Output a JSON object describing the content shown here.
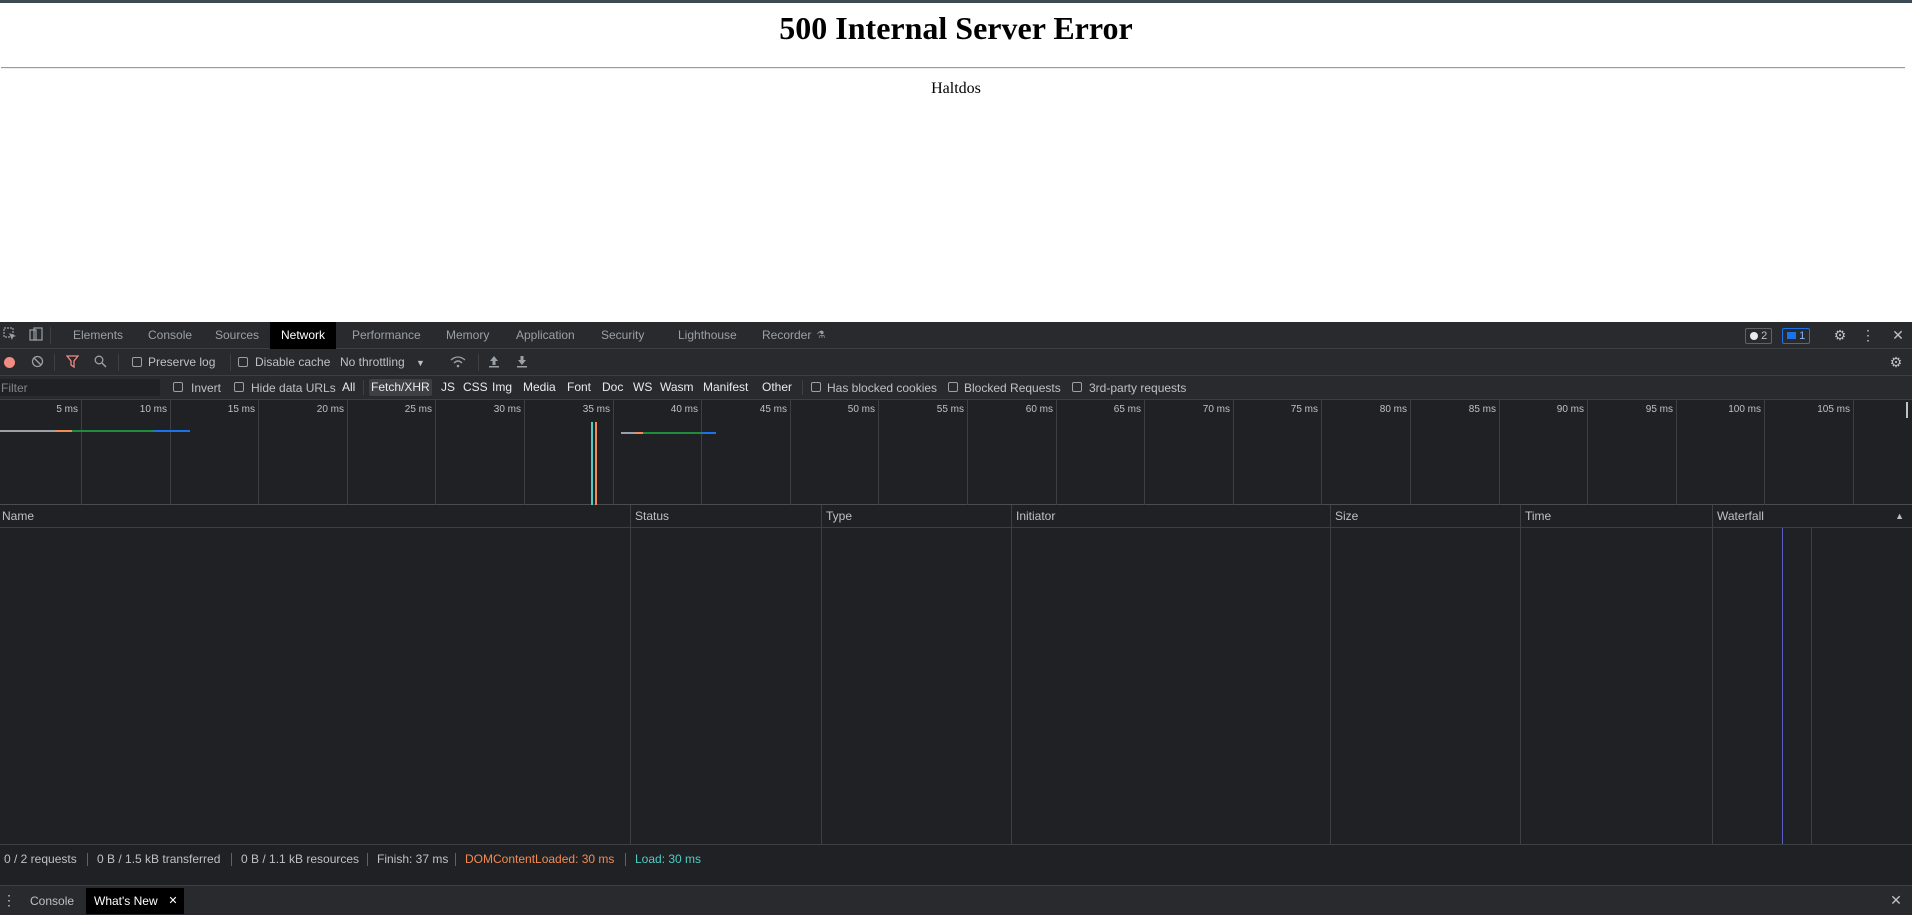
{
  "page": {
    "heading": "500 Internal Server Error",
    "server_name": "Haltdos"
  },
  "devtools": {
    "tabs": [
      "Elements",
      "Console",
      "Sources",
      "Network",
      "Performance",
      "Memory",
      "Application",
      "Security",
      "Lighthouse",
      "Recorder"
    ],
    "active_tab": "Network",
    "issues_count": "2",
    "messages_count": "1",
    "toolbar": {
      "preserve_log": "Preserve log",
      "disable_cache": "Disable cache",
      "throttling": "No throttling"
    },
    "filter": {
      "placeholder": "Filter",
      "invert": "Invert",
      "hide_data_urls": "Hide data URLs",
      "types": [
        "All",
        "Fetch/XHR",
        "JS",
        "CSS",
        "Img",
        "Media",
        "Font",
        "Doc",
        "WS",
        "Wasm",
        "Manifest",
        "Other"
      ],
      "active_type": "Fetch/XHR",
      "has_blocked_cookies": "Has blocked cookies",
      "blocked_requests": "Blocked Requests",
      "third_party": "3rd-party requests"
    },
    "overview_ticks": [
      "5 ms",
      "10 ms",
      "15 ms",
      "20 ms",
      "25 ms",
      "30 ms",
      "35 ms",
      "40 ms",
      "45 ms",
      "50 ms",
      "55 ms",
      "60 ms",
      "65 ms",
      "70 ms",
      "75 ms",
      "80 ms",
      "85 ms",
      "90 ms",
      "95 ms",
      "100 ms",
      "105 ms"
    ],
    "columns": [
      "Name",
      "Status",
      "Type",
      "Initiator",
      "Size",
      "Time",
      "Waterfall"
    ],
    "status": {
      "requests": "0 / 2 requests",
      "transferred": "0 B / 1.5 kB transferred",
      "resources": "0 B / 1.1 kB resources",
      "finish": "Finish: 37 ms",
      "dom_content_loaded": "DOMContentLoaded: 30 ms",
      "load": "Load: 30 ms"
    },
    "drawer": {
      "tabs": [
        "Console",
        "What's New"
      ],
      "active_tab": "What's New"
    },
    "colors": {
      "dom_content_loaded": "#f28b54",
      "load": "#4ecdc4",
      "record": "#f28b82"
    }
  }
}
